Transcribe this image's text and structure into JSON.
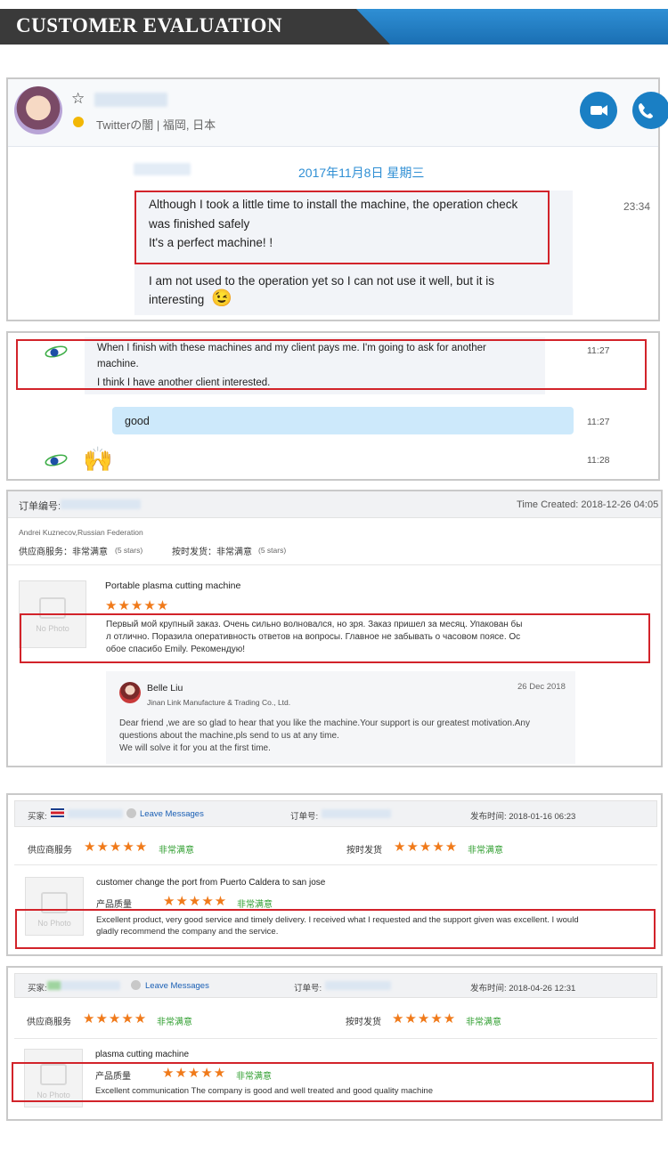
{
  "header": {
    "title": "CUSTOMER EVALUATION"
  },
  "chat1": {
    "user_location": "Twitterの闇 | 福岡, 日本",
    "date": "2017年11月8日 星期三",
    "msg1_line1": "Although I took a little time to install the machine, the operation check",
    "msg1_line2": "was finished safely",
    "msg1_line3": "It's a perfect machine! !",
    "time": "23:34",
    "msg2_line1": "I am not used to the operation yet so I can not use it well, but it is",
    "msg2_line2": "interesting",
    "emoji": "😉",
    "colors": {
      "call_button": "#1a7fc4"
    }
  },
  "chat2": {
    "msg1_line1": "When I finish with these machines and my client pays me. I'm going to ask for another",
    "msg1_line2": "machine.",
    "msg1_line3": "I think I have another client interested.",
    "time1": "11:27",
    "reply": "good",
    "time2": "11:27",
    "emoji": "🙌",
    "time3": "11:28"
  },
  "review1": {
    "order_label": "订单编号:",
    "time_created": "Time Created: 2018-12-26 04:05",
    "buyer": "Andrei Kuznecov,Russian Federation",
    "supplier_label": "供应商服务：非常满意",
    "supplier_stars": "(5 stars)",
    "delivery_label": "按时发货：非常满意",
    "delivery_stars": "(5 stars)",
    "product": "Portable plasma cutting machine",
    "stars": "★★★★★",
    "nophoto": "No Photo",
    "comment_line1": "Первый мой крупный заказ. Очень сильно волновался, но зря. Заказ пришел за месяц. Упакован бы",
    "comment_line2": "л отлично. Поразила оперативность ответов на вопросы. Главное не забывать о часовом поясе. Ос",
    "comment_line3": "обое спасибо Emily. Рекомендую!",
    "reply_name": "Belle Liu",
    "reply_company": "Jinan Link Manufacture & Trading Co., Ltd.",
    "reply_date": "26 Dec 2018",
    "reply_line1": "Dear friend ,we are so glad to hear that you like the machine.Your support is our greatest motivation.Any",
    "reply_line2": "questions about the machine,pls send to us at any time.",
    "reply_line3": "We will solve it for you at the first time."
  },
  "review2": {
    "buyer_label": "买家:",
    "leave_messages": "Leave Messages",
    "order_label": "订单号:",
    "published": "发布时间: 2018-01-16 06:23",
    "supplier_label": "供应商服务",
    "delivery_label": "按时发货",
    "stars": "★★★★★",
    "very_satisfied": "非常满意",
    "product": "customer change the port from Puerto Caldera to san jose",
    "quality_label": "产品质量",
    "nophoto": "No Photo",
    "comment_line1": "Excellent product, very good service and timely delivery. I received what I requested and the support given was excellent. I would",
    "comment_line2": "gladly recommend the company and the service."
  },
  "review3": {
    "buyer_label": "买家:",
    "leave_messages": "Leave Messages",
    "order_label": "订单号:",
    "published": "发布时间: 2018-04-26 12:31",
    "supplier_label": "供应商服务",
    "delivery_label": "按时发货",
    "stars": "★★★★★",
    "very_satisfied": "非常满意",
    "product": "plasma cutting machine",
    "quality_label": "产品质量",
    "nophoto": "No Photo",
    "comment": "Excellent communication The company is good and well treated and good quality machine"
  }
}
